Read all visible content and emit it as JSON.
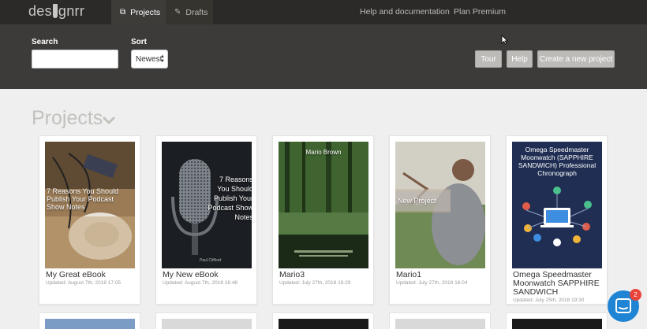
{
  "nav": {
    "logo": "designrr",
    "tabs": [
      {
        "label": "Projects",
        "icon": "projects-icon"
      },
      {
        "label": "Drafts",
        "icon": "pencil-icon"
      }
    ],
    "help_link": "Help and documentation",
    "plan_link": "Plan Premium"
  },
  "toolbar": {
    "search_label": "Search",
    "search_value": "",
    "sort_label": "Sort",
    "sort_value": "Newest",
    "tour_label": "Tour",
    "help_label": "Help",
    "create_label": "Create a new project"
  },
  "section": {
    "title": "Projects"
  },
  "projects": [
    {
      "title": "My Great eBook",
      "updated": "Updated: August 7th, 2018 17:05",
      "cover_text": "7 Reasons You Should Publish Your Podcast Show Notes"
    },
    {
      "title": "My New eBook",
      "updated": "Updated: August 7th, 2018 16:48",
      "cover_text": "7 Reasons You Should Publish Your Podcast Show Notes",
      "cover_author": "Paul Clifford"
    },
    {
      "title": "Mario3",
      "updated": "Updated: July 27th, 2018 16:29",
      "cover_text": "Mario Brown"
    },
    {
      "title": "Mario1",
      "updated": "Updated: July 27th, 2018 16:04",
      "cover_text": "New Project"
    },
    {
      "title": "Omega Speedmaster Moonwatch SAPPHIRE SANDWICH",
      "updated": "Updated: July 25th, 2018 19:30",
      "cover_text": "Omega Speedmaster Moonwatch (SAPPHIRE SANDWICH) Professional Chronograph"
    }
  ],
  "chat": {
    "badge": "2"
  },
  "colors": {
    "topnav_bg": "#2b2a28",
    "toolbar_bg": "#3d3b39",
    "page_bg": "#efefef",
    "button_bg": "#bdbbb8",
    "chat_blue": "#1f84d4",
    "badge_red": "#e8443a"
  }
}
